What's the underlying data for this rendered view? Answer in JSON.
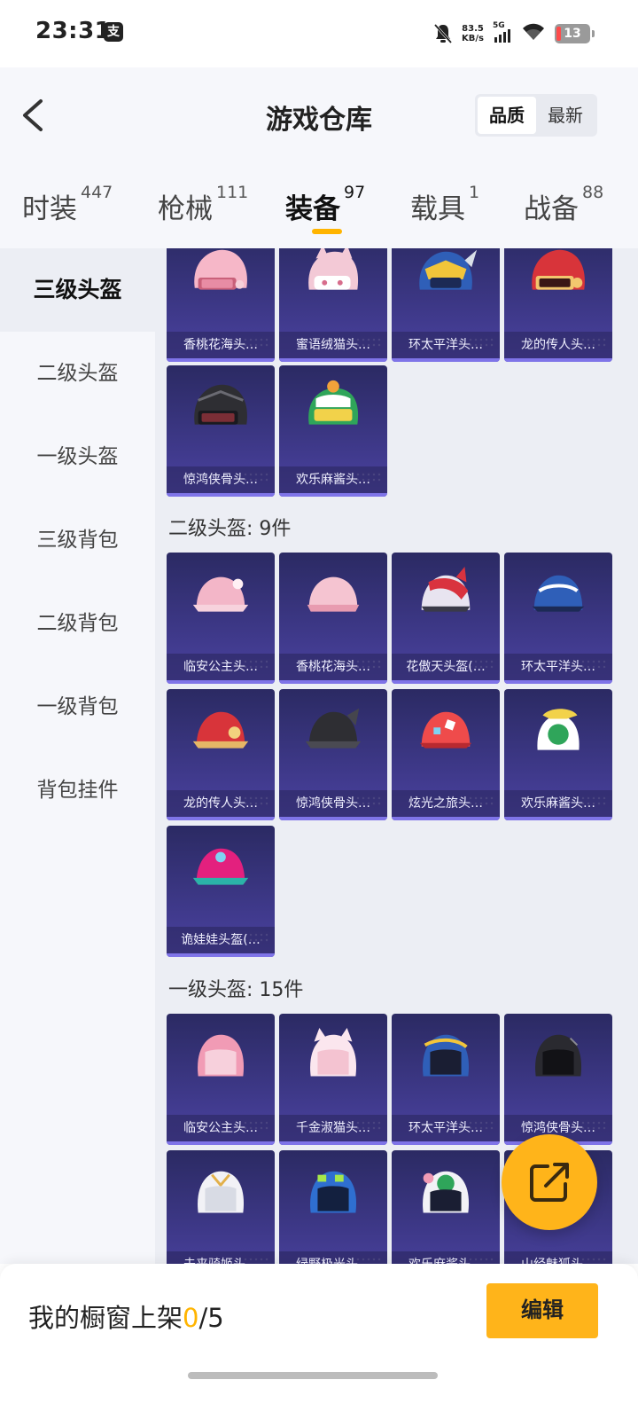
{
  "status_bar": {
    "time": "23:31",
    "app_icon_glyph": "支",
    "net_speed_value": "83.5",
    "net_speed_unit": "KB/s",
    "signal_type": "5G",
    "battery_level": "13",
    "icons": [
      "notifications-off-icon",
      "signal-icon",
      "wifi-icon",
      "battery-icon"
    ]
  },
  "header": {
    "title": "游戏仓库",
    "sort_options": [
      "品质",
      "最新"
    ],
    "active_sort": "品质"
  },
  "tabs": [
    {
      "label": "时装",
      "count": "447"
    },
    {
      "label": "枪械",
      "count": "111"
    },
    {
      "label": "装备",
      "count": "97",
      "active": true
    },
    {
      "label": "载具",
      "count": "1"
    },
    {
      "label": "战备",
      "count": "88"
    }
  ],
  "sidebar": {
    "items": [
      "三级头盔",
      "二级头盔",
      "一级头盔",
      "三级背包",
      "二级背包",
      "一级背包",
      "背包挂件"
    ],
    "active_index": 0
  },
  "sections": {
    "level3": {
      "items": [
        "香桃花海头…",
        "蜜语绒猫头…",
        "环太平洋头…",
        "龙的传人头…",
        "惊鸿侠骨头…",
        "欢乐麻酱头…"
      ]
    },
    "level2": {
      "title": "二级头盔: 9件",
      "items": [
        "临安公主头…",
        "香桃花海头…",
        "花傲天头盔(…",
        "环太平洋头…",
        "龙的传人头…",
        "惊鸿侠骨头…",
        "炫光之旅头…",
        "欢乐麻酱头…",
        "诡娃娃头盔(…"
      ]
    },
    "level1": {
      "title": "一级头盔: 15件",
      "items": [
        "临安公主头…",
        "千金淑猫头…",
        "环太平洋头…",
        "惊鸿侠骨头…",
        "未来骑姬头…",
        "绿野极光头…",
        "欢乐麻酱头…",
        "山经魅狐头…"
      ]
    }
  },
  "bottom_bar": {
    "showcase_label": "我的橱窗上架",
    "showcase_count": "0",
    "showcase_total": "/5",
    "edit_label": "编辑"
  },
  "colors": {
    "accent": "#ffb41a",
    "card_top": "#2b2a63",
    "card_bottom": "#4b42a1"
  }
}
